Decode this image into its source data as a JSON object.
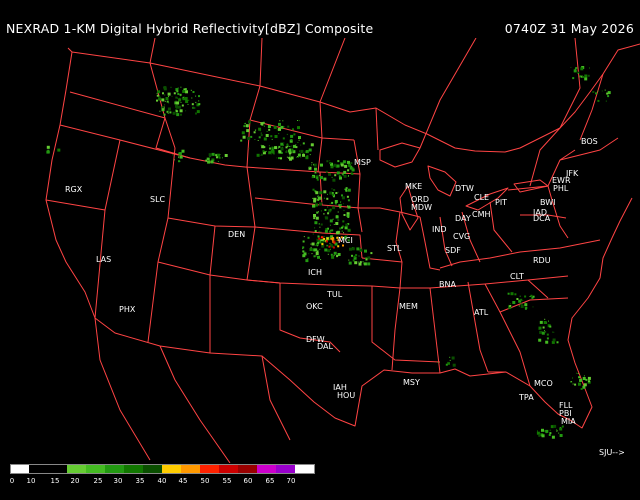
{
  "header": {
    "title": "NEXRAD 1-KM Digital Hybrid Reflectivity[dBZ] Composite",
    "timestamp": "0740Z 31 May 2026"
  },
  "map": {
    "border_color": "#ff4444",
    "background": "#000000",
    "cities": [
      {
        "code": "BOS"
      },
      {
        "code": "JFK"
      },
      {
        "code": "EWR"
      },
      {
        "code": "PHL"
      },
      {
        "code": "BWI"
      },
      {
        "code": "IAD"
      },
      {
        "code": "DCA"
      },
      {
        "code": "PIT"
      },
      {
        "code": "DTW"
      },
      {
        "code": "CLE"
      },
      {
        "code": "CMH"
      },
      {
        "code": "DAY"
      },
      {
        "code": "CVG"
      },
      {
        "code": "SDF"
      },
      {
        "code": "IND"
      },
      {
        "code": "ORD"
      },
      {
        "code": "MDW"
      },
      {
        "code": "MKE"
      },
      {
        "code": "MSP"
      },
      {
        "code": "MCI"
      },
      {
        "code": "STL"
      },
      {
        "code": "ICH"
      },
      {
        "code": "TUL"
      },
      {
        "code": "OKC"
      },
      {
        "code": "DFW"
      },
      {
        "code": "DAL"
      },
      {
        "code": "IAH"
      },
      {
        "code": "HOU"
      },
      {
        "code": "MSY"
      },
      {
        "code": "MEM"
      },
      {
        "code": "BNA"
      },
      {
        "code": "ATL"
      },
      {
        "code": "CLT"
      },
      {
        "code": "RDU"
      },
      {
        "code": "MCO"
      },
      {
        "code": "TPA"
      },
      {
        "code": "FLL"
      },
      {
        "code": "PBI"
      },
      {
        "code": "MIA"
      },
      {
        "code": "DEN"
      },
      {
        "code": "SLC"
      },
      {
        "code": "LAS"
      },
      {
        "code": "PHX"
      },
      {
        "code": "RGX"
      }
    ]
  },
  "legend": {
    "colors": [
      "#ffffff",
      "#000000",
      "#000000",
      "#66cc33",
      "#44bb22",
      "#229911",
      "#117700",
      "#0a4f00",
      "#ffcc00",
      "#ff9900",
      "#ff2200",
      "#cc0000",
      "#990000",
      "#cc00cc",
      "#9900cc",
      "#ffffff"
    ],
    "ticks": [
      "0",
      "10",
      "15",
      "20",
      "25",
      "30",
      "35",
      "40",
      "45",
      "50",
      "55",
      "60",
      "65",
      "70"
    ]
  },
  "credit": "SJU-->"
}
